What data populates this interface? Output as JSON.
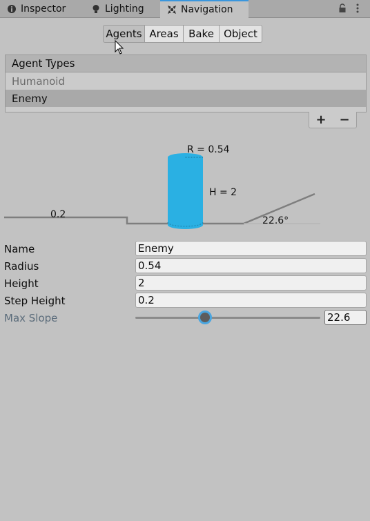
{
  "tabs": {
    "inspector": "Inspector",
    "lighting": "Lighting",
    "navigation": "Navigation"
  },
  "toolbar": {
    "agents": "Agents",
    "areas": "Areas",
    "bake": "Bake",
    "object": "Object"
  },
  "agent_list": {
    "header": "Agent Types",
    "items": [
      "Humanoid",
      "Enemy"
    ],
    "selected": "Enemy",
    "add": "+",
    "remove": "−"
  },
  "diagram": {
    "radius_label": "R = 0.54",
    "height_label": "H = 2",
    "step_label": "0.2",
    "slope_label": "22.6°",
    "agent_color": "#2ab0e3"
  },
  "properties": {
    "name_label": "Name",
    "name_value": "Enemy",
    "radius_label": "Radius",
    "radius_value": "0.54",
    "height_label": "Height",
    "height_value": "2",
    "step_label": "Step Height",
    "step_value": "0.2",
    "slope_label": "Max Slope",
    "slope_value": "22.6",
    "slope_fraction": 0.377
  },
  "colors": {
    "accent": "#3a96dd",
    "panel": "#c2c2c2"
  }
}
